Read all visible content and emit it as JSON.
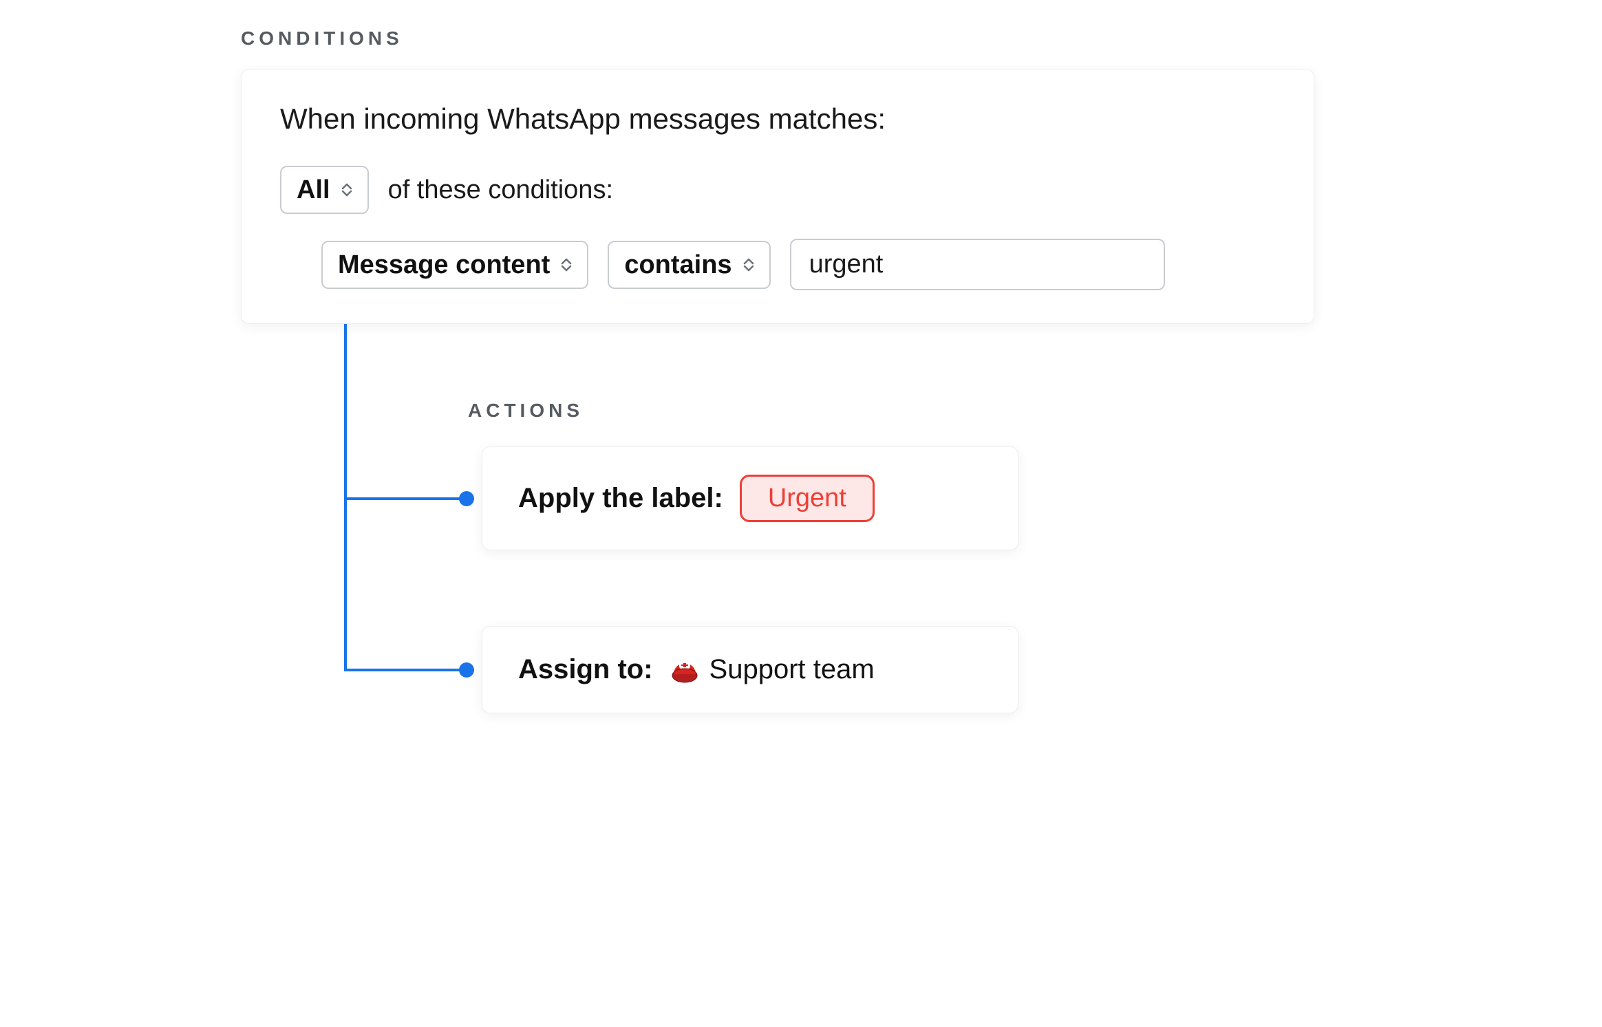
{
  "sections": {
    "conditions_label": "CONDITIONS",
    "actions_label": "ACTIONS"
  },
  "conditions": {
    "title": "When incoming WhatsApp messages matches:",
    "match_mode": "All",
    "match_suffix": "of these conditions:",
    "rule": {
      "field": "Message content",
      "operator": "contains",
      "value": "urgent"
    }
  },
  "actions": [
    {
      "kind": "apply_label",
      "label_text": "Apply the label:",
      "tag_value": "Urgent",
      "tag_color": "#ef3e36"
    },
    {
      "kind": "assign",
      "label_text": "Assign to:",
      "assignee_icon": "rescue-helmet-emoji",
      "assignee_name": "Support team"
    }
  ],
  "colors": {
    "connector": "#1a73e8",
    "tag_border": "#ef3e36",
    "tag_bg": "#fde8e7"
  }
}
